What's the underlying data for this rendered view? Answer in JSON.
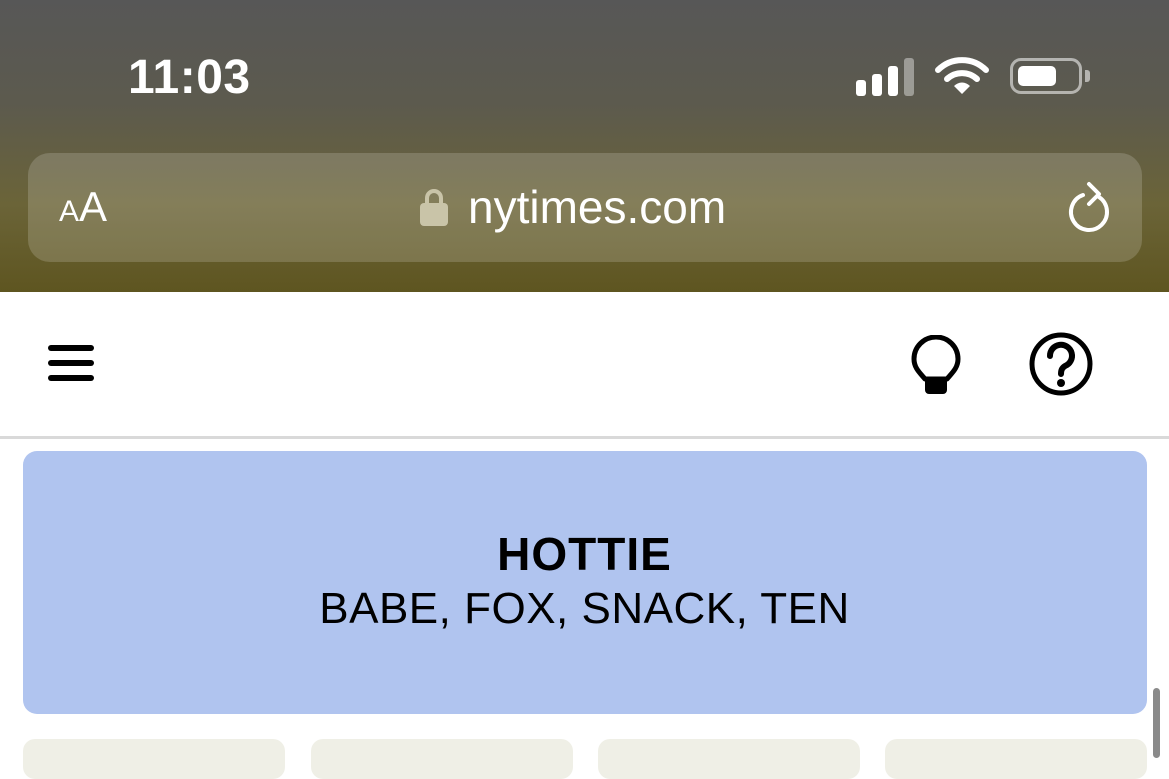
{
  "status_bar": {
    "time": "11:03",
    "signal_icon": "cellular-signal-icon",
    "wifi_icon": "wifi-icon",
    "battery_icon": "battery-icon"
  },
  "browser": {
    "text_size_button": {
      "small": "A",
      "large": "A"
    },
    "lock_icon": "lock-icon",
    "domain": "nytimes.com",
    "reload_icon": "reload-icon"
  },
  "page_header": {
    "menu_icon": "hamburger-menu-icon",
    "hint_icon": "lightbulb-icon",
    "help_icon": "help-icon"
  },
  "solved_group": {
    "category": "HOTTIE",
    "words": "BABE, FOX, SNACK, TEN",
    "color": "#b0c4ef"
  },
  "colors": {
    "tile_background": "#efefe6"
  }
}
